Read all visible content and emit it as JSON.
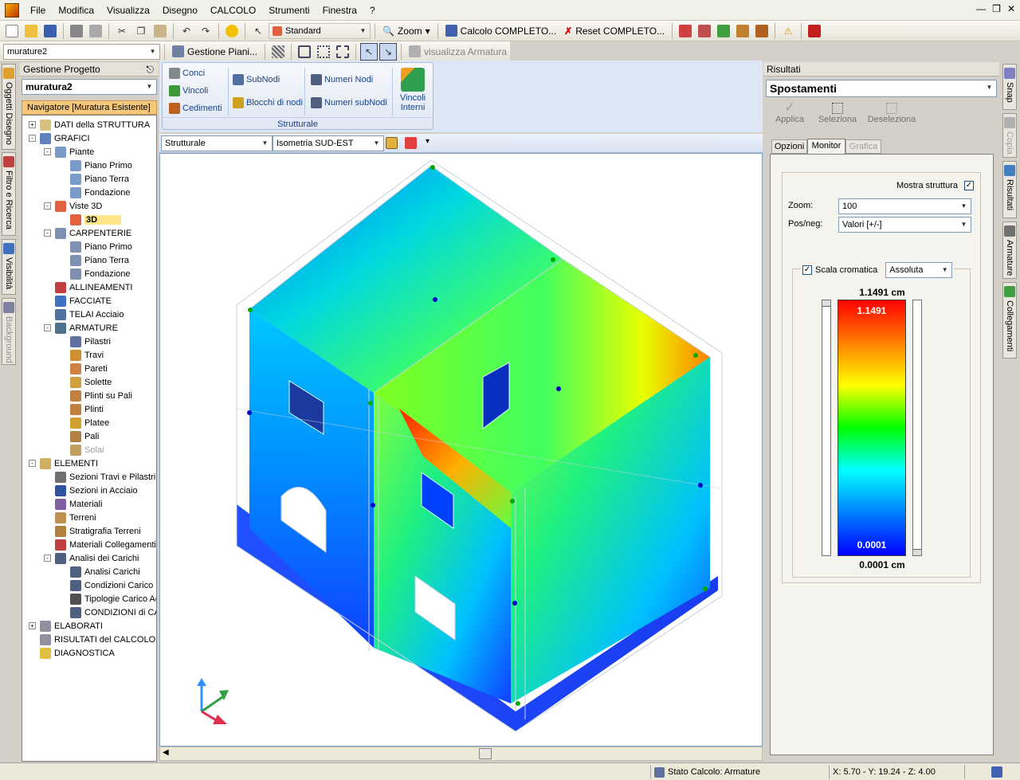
{
  "menu": [
    "File",
    "Modifica",
    "Visualizza",
    "Disegno",
    "CALCOLO",
    "Strumenti",
    "Finestra",
    "?"
  ],
  "toolbar1": {
    "style_combo": "Standard",
    "zoom_label": "Zoom",
    "calc_complete": "Calcolo COMPLETO...",
    "reset_complete": "Reset COMPLETO..."
  },
  "toolbar2": {
    "project_combo": "murature2",
    "gestione_piani": "Gestione Piani...",
    "visualizza_armatura": "visualizza Armatura"
  },
  "left_tabs": [
    "Oggetti Disegno",
    "Filtro e Ricerca",
    "Visibilità",
    "Background"
  ],
  "gestione": {
    "title": "Gestione Progetto",
    "combo": "muratura2",
    "navigator": "Navigatore [Muratura Esistente]"
  },
  "tree": [
    {
      "label": "DATI della STRUTTURA",
      "level": 0,
      "exp": "+",
      "icon": "book-icon"
    },
    {
      "label": "GRAFICI",
      "level": 0,
      "exp": "-",
      "icon": "graph-icon"
    },
    {
      "label": "Piante",
      "level": 1,
      "exp": "-",
      "icon": "plan-icon"
    },
    {
      "label": "Piano Primo",
      "level": 2,
      "icon": "plan-icon"
    },
    {
      "label": "Piano Terra",
      "level": 2,
      "icon": "plan-icon"
    },
    {
      "label": "Fondazione",
      "level": 2,
      "icon": "plan-icon"
    },
    {
      "label": "Viste 3D",
      "level": 1,
      "exp": "-",
      "icon": "3d-icon"
    },
    {
      "label": "3D",
      "level": 2,
      "icon": "3d-icon",
      "selected": true
    },
    {
      "label": "CARPENTERIE",
      "level": 1,
      "exp": "-",
      "icon": "grid-icon"
    },
    {
      "label": "Piano Primo",
      "level": 2,
      "icon": "grid-icon"
    },
    {
      "label": "Piano Terra",
      "level": 2,
      "icon": "grid-icon"
    },
    {
      "label": "Fondazione",
      "level": 2,
      "icon": "grid-icon"
    },
    {
      "label": "ALLINEAMENTI",
      "level": 1,
      "icon": "align-icon"
    },
    {
      "label": "FACCIATE",
      "level": 1,
      "icon": "house-icon"
    },
    {
      "label": "TELAI Acciaio",
      "level": 1,
      "icon": "frame-icon"
    },
    {
      "label": "ARMATURE",
      "level": 1,
      "exp": "-",
      "icon": "rebar-icon"
    },
    {
      "label": "Pilastri",
      "level": 2,
      "icon": "pillar-icon"
    },
    {
      "label": "Travi",
      "level": 2,
      "icon": "beam-icon"
    },
    {
      "label": "Pareti",
      "level": 2,
      "icon": "wall-icon"
    },
    {
      "label": "Solette",
      "level": 2,
      "icon": "slab-icon"
    },
    {
      "label": "Plinti su Pali",
      "level": 2,
      "icon": "plinth-icon"
    },
    {
      "label": "Plinti",
      "level": 2,
      "icon": "plinth-icon"
    },
    {
      "label": "Platee",
      "level": 2,
      "icon": "raft-icon"
    },
    {
      "label": "Pali",
      "level": 2,
      "icon": "pile-icon"
    },
    {
      "label": "Solai",
      "level": 2,
      "icon": "floor-icon",
      "disabled": true
    },
    {
      "label": "ELEMENTI",
      "level": 0,
      "exp": "-",
      "icon": "elements-icon"
    },
    {
      "label": "Sezioni Travi e Pilastri",
      "level": 1,
      "icon": "section-icon"
    },
    {
      "label": "Sezioni in Acciaio",
      "level": 1,
      "icon": "steel-icon"
    },
    {
      "label": "Materiali",
      "level": 1,
      "icon": "material-icon"
    },
    {
      "label": "Terreni",
      "level": 1,
      "icon": "soil-icon"
    },
    {
      "label": "Stratigrafia Terreni",
      "level": 1,
      "icon": "strata-icon"
    },
    {
      "label": "Materiali Collegamenti",
      "level": 1,
      "icon": "connection-icon"
    },
    {
      "label": "Analisi dei Carichi",
      "level": 1,
      "exp": "-",
      "icon": "load-icon"
    },
    {
      "label": "Analisi Carichi",
      "level": 2,
      "icon": "load-icon"
    },
    {
      "label": "Condizioni Carico U",
      "level": 2,
      "icon": "load-icon"
    },
    {
      "label": "Tipologie Carico Ac",
      "level": 2,
      "icon": "abc-icon"
    },
    {
      "label": "CONDIZIONI di CAI",
      "level": 2,
      "icon": "load-icon"
    },
    {
      "label": "ELABORATI",
      "level": 0,
      "exp": "+",
      "icon": "doc-icon"
    },
    {
      "label": "RISULTATI del CALCOLO",
      "level": 0,
      "icon": "doc-icon"
    },
    {
      "label": "DIAGNOSTICA",
      "level": 0,
      "icon": "warning-icon"
    }
  ],
  "ribbon": {
    "conci": "Conci",
    "vincoli": "Vincoli",
    "cedimenti": "Cedimenti",
    "subnodi": "SubNodi",
    "blocchi": "Blocchi di nodi",
    "numeri_nodi": "Numeri Nodi",
    "numeri_subnodi": "Numeri subNodi",
    "vincoli_interni_1": "Vincoli",
    "vincoli_interni_2": "Interni",
    "group": "Strutturale"
  },
  "view_toolbar": {
    "mode": "Strutturale",
    "view": "Isometria SUD-EST"
  },
  "results": {
    "title": "Risultati",
    "combo": "Spostamenti",
    "applica": "Applica",
    "seleziona": "Seleziona",
    "deseleziona": "Deseleziona",
    "tabs": [
      "Opzioni",
      "Monitor",
      "Grafica"
    ],
    "mostra_struttura": "Mostra struttura",
    "zoom_label": "Zoom:",
    "zoom_value": "100",
    "posneg_label": "Pos/neg:",
    "posneg_value": "Valori  [+/-]",
    "scala_label": "Scala cromatica",
    "scala_mode": "Assoluta",
    "max_label": "1.1491 cm",
    "max_inner": "1.1491",
    "min_inner": "0.0001",
    "min_label": "0.0001 cm",
    "legend_colors": [
      "#ff0000",
      "#ff8000",
      "#ffff00",
      "#00ff00",
      "#00ffff",
      "#0080ff",
      "#0000ff"
    ]
  },
  "right_tabs": [
    "Snap",
    "Copia",
    "Risultati",
    "Armature",
    "Collegamenti"
  ],
  "status": {
    "stato": "Stato Calcolo: Armature",
    "coords": "X: 5.70 - Y: 19.24 - Z: 4.00"
  }
}
